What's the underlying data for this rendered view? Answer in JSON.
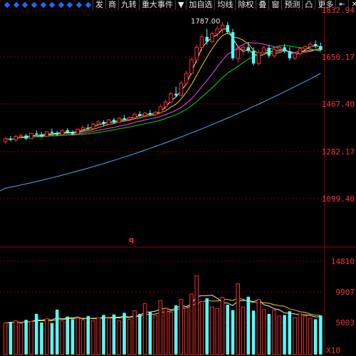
{
  "toolbar": {
    "diamond_count": 10,
    "buttons": [
      "发",
      "商",
      "九转",
      "重大事件",
      "▼",
      "加自选",
      "均线",
      "除权",
      "叠",
      "窗",
      "预测",
      "凸",
      "更多"
    ],
    "right_icon": "⇤",
    "close_icon": "✕"
  },
  "peak_label": "1787.00",
  "marker_text": "q",
  "volume_unit": "X10",
  "colors": {
    "background": "#000000",
    "up": "#ff3030",
    "down": "#54ffff",
    "grid": "#8b0000",
    "ma5": "#e8e8e8",
    "ma10": "#f0d000",
    "ma20": "#ff40ff",
    "ma30": "#00e000",
    "ma60": "#3fb0ff"
  },
  "chart_data": [
    {
      "type": "candlestick",
      "title": "",
      "yticks": [
        "1832.94",
        "1650.17",
        "1467.40",
        "1282.17",
        "1099.40"
      ],
      "ylim": [
        930,
        1832.94
      ],
      "candles": [
        [
          1330,
          1345,
          1320,
          1340
        ],
        [
          1340,
          1350,
          1330,
          1335
        ],
        [
          1335,
          1355,
          1328,
          1348
        ],
        [
          1348,
          1360,
          1340,
          1352
        ],
        [
          1352,
          1358,
          1335,
          1340
        ],
        [
          1340,
          1362,
          1338,
          1360
        ],
        [
          1360,
          1372,
          1352,
          1356
        ],
        [
          1356,
          1365,
          1345,
          1348
        ],
        [
          1348,
          1368,
          1346,
          1366
        ],
        [
          1366,
          1378,
          1360,
          1362
        ],
        [
          1362,
          1370,
          1350,
          1355
        ],
        [
          1355,
          1375,
          1352,
          1372
        ],
        [
          1372,
          1380,
          1360,
          1364
        ],
        [
          1364,
          1372,
          1355,
          1358
        ],
        [
          1358,
          1378,
          1356,
          1376
        ],
        [
          1376,
          1390,
          1370,
          1382
        ],
        [
          1382,
          1395,
          1374,
          1378
        ],
        [
          1378,
          1400,
          1376,
          1396
        ],
        [
          1396,
          1412,
          1390,
          1404
        ],
        [
          1404,
          1410,
          1390,
          1395
        ],
        [
          1395,
          1415,
          1392,
          1412
        ],
        [
          1412,
          1420,
          1398,
          1402
        ],
        [
          1402,
          1422,
          1400,
          1418
        ],
        [
          1418,
          1430,
          1410,
          1414
        ],
        [
          1414,
          1426,
          1406,
          1420
        ],
        [
          1420,
          1440,
          1416,
          1434
        ],
        [
          1434,
          1445,
          1424,
          1428
        ],
        [
          1428,
          1442,
          1422,
          1438
        ],
        [
          1438,
          1450,
          1428,
          1432
        ],
        [
          1432,
          1446,
          1425,
          1440
        ],
        [
          1440,
          1470,
          1436,
          1462
        ],
        [
          1462,
          1490,
          1455,
          1480
        ],
        [
          1480,
          1520,
          1476,
          1512
        ],
        [
          1512,
          1540,
          1500,
          1506
        ],
        [
          1506,
          1560,
          1502,
          1552
        ],
        [
          1552,
          1600,
          1545,
          1590
        ],
        [
          1590,
          1650,
          1582,
          1642
        ],
        [
          1642,
          1700,
          1630,
          1690
        ],
        [
          1690,
          1740,
          1676,
          1730
        ],
        [
          1730,
          1760,
          1700,
          1712
        ],
        [
          1712,
          1750,
          1705,
          1742
        ],
        [
          1742,
          1770,
          1728,
          1760
        ],
        [
          1760,
          1787,
          1745,
          1775
        ],
        [
          1775,
          1787,
          1740,
          1748
        ],
        [
          1748,
          1760,
          1640,
          1648
        ],
        [
          1648,
          1690,
          1630,
          1682
        ],
        [
          1682,
          1700,
          1660,
          1690
        ],
        [
          1690,
          1710,
          1668,
          1676
        ],
        [
          1676,
          1690,
          1620,
          1628
        ],
        [
          1628,
          1680,
          1620,
          1670
        ],
        [
          1670,
          1695,
          1660,
          1688
        ],
        [
          1688,
          1700,
          1650,
          1658
        ],
        [
          1658,
          1690,
          1650,
          1682
        ],
        [
          1682,
          1698,
          1668,
          1690
        ],
        [
          1690,
          1702,
          1668,
          1675
        ],
        [
          1675,
          1690,
          1640,
          1648
        ],
        [
          1648,
          1672,
          1640,
          1666
        ],
        [
          1666,
          1690,
          1658,
          1684
        ],
        [
          1684,
          1698,
          1672,
          1692
        ],
        [
          1692,
          1710,
          1680,
          1702
        ],
        [
          1702,
          1716,
          1686,
          1694
        ],
        [
          1694,
          1708,
          1676,
          1680
        ]
      ],
      "series": [
        {
          "name": "",
          "color_key": "ma5",
          "smooth": 3
        },
        {
          "name": "",
          "color_key": "ma10",
          "smooth": 6
        },
        {
          "name": "",
          "color_key": "ma20",
          "smooth": 12
        },
        {
          "name": "",
          "color_key": "ma30",
          "smooth": 18
        },
        {
          "name": "",
          "color_key": "ma60",
          "values_start": 1150,
          "values_end": 1590
        }
      ]
    },
    {
      "type": "bar",
      "title": "",
      "yticks": [
        "14810",
        "9907",
        "5003"
      ],
      "ylim": [
        0,
        14810
      ],
      "values": [
        1900,
        2100,
        2300,
        1800,
        2500,
        2200,
        3600,
        2000,
        2700,
        1900,
        4400,
        2300,
        3100,
        2600,
        2800,
        2500,
        3200,
        2300,
        2900,
        3400,
        2800,
        3500,
        2300,
        3800,
        2600,
        4200,
        3600,
        5500,
        3900,
        3300,
        6100,
        4600,
        3900,
        5200,
        6300,
        4700,
        7300,
        10700,
        5900,
        6500,
        4900,
        4600,
        6700,
        5300,
        4300,
        9200,
        4900,
        6800,
        4200,
        6300,
        4400,
        3600,
        4300,
        3200,
        3400,
        4100,
        2900,
        3600,
        3200,
        2800,
        2600,
        3300
      ]
    }
  ]
}
